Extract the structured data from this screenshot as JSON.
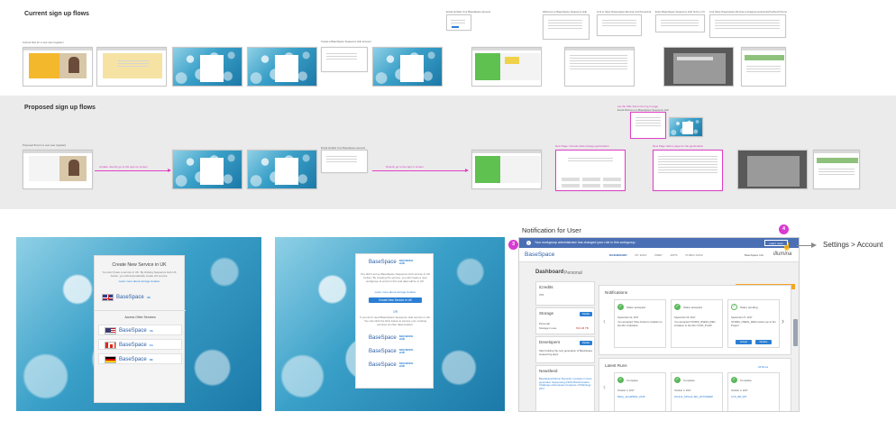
{
  "sections": {
    "current_title": "Current sign up flows",
    "proposed_title": "Proposed sign up flows"
  },
  "current_captions": {
    "c1": "Current flow for a new user (register)",
    "c2": "Create a BaseSpace Sequence Hub account",
    "c3": "Email Verified Your BaseSpace account",
    "c4": "Welcome to BaseSpace Sequence Hub",
    "c5": "Link to https://basespace.illumina.com/home/index",
    "c6": "Enter BaseSpace Sequence Hub Terms of Use Accepted",
    "c7": "Link https://basespace.illumina.com/agreements/eula?redirect=/home"
  },
  "proposed_captions": {
    "p1": "Proposed flow for a new user (register)",
    "p_arrow1": "Update: directly go to the sign up screen",
    "p_arrow2": "Directly go to the sign in screen",
    "p3": "Email Verified Your BaseSpace account",
    "p_new_choose": "New Page: Choose data storage geolocation",
    "p_top_note": "Let the URL link to the log in page",
    "p_top_note2": "Email Welcome to BaseSpace Sequence Hub",
    "p_new_geo": "New Page: Edit a page for the geolocation"
  },
  "create_dialog": {
    "title": "Create New Service in UK",
    "text": "You don't have a service in UK. By clicking Sequence Hub UK button, you will automatically create UK service.",
    "link": "Learn more about storage location",
    "basespace": "BaseSpace",
    "hub": "SEQUENCE\nHUB",
    "hub_region": "UK",
    "access_title": "Access Other Services",
    "regions": [
      "US",
      "CA",
      "DE"
    ]
  },
  "second_dialog": {
    "text": "You didn't set up BaseSpace Sequence Hub service in UK before. By creating the service, you will create a new workgroup at work for this and data will be in UK.",
    "link": "Learn more about storage location",
    "button": "Create New Service in UK",
    "or": "OR",
    "or_text": "If you don't need BaseSpace Sequence Hub service in UK. You can click the links below to access your existing services at other data location.",
    "basespace": "BaseSpace",
    "hub": "SEQUENCE\nHUB"
  },
  "notification": {
    "heading": "Notification for User",
    "banner": "Your workgroup administrator has changed your role in this workgroup.",
    "banner_button": "Learn more",
    "badge_left": "3",
    "badge_right": "4",
    "arrow_target": "Settings > Account",
    "app_logo": "BaseSpace",
    "nav": [
      "DASHBOARD",
      "MY DATA",
      "PREP",
      "APPS",
      "PUBLIC DATA"
    ],
    "illumina": "illumina",
    "user": "BaseSpace Info",
    "dashboard_title": "Dashboard",
    "dashboard_scope": "Personal",
    "alert": "We've made some changes. Visit their ...",
    "icredits": "iCredits",
    "icredits_value": "379",
    "storage": "Storage",
    "storage_button": "Details",
    "storage_personal": "Personal",
    "storage_line2": "Storage in use",
    "storage_value": "519.48 TB",
    "developers": "Developers",
    "developers_button": "Details",
    "developers_text": "Start building the next generation of BaseSpace sequencing apps.",
    "newsfeed": "Newsfeed",
    "newsfeed_text": "BaseSpace/Partner Recorder complete in Next-generation Sequencing (NGS) Bioinformatics Challenge at European Congress of Pathology 2017",
    "notifications_title": "Notifications",
    "cards": [
      {
        "status": "Share accepted",
        "date": "September 22, 2017",
        "text": "You accepted Yilian Fisher's invitation to the Run Individual"
      },
      {
        "status": "Share accepted",
        "date": "September 26, 2017",
        "text": "You accepted ST2000_OSE91_REN invitation to the Run ST2K_PoolD"
      },
      {
        "status": "Share pending",
        "date": "September 27, 2017",
        "text": "ST2000_OSE91_REN invited you to the Project",
        "accept": "Accept",
        "decline": "Decline"
      }
    ],
    "latest_runs": "Latest Runs",
    "all_runs": "All Runs",
    "runs": [
      {
        "status": "Complete",
        "date": "October 3, 2017",
        "name": "Mlboy_EcoliPBH4_2X45"
      },
      {
        "status": "Complete",
        "date": "October 3, 2017",
        "name": "101313_SPS-HL-MH_2NTSNMEP"
      },
      {
        "status": "Complete",
        "date": "October 3, 2017",
        "name": "LOS_DB_MIT"
      }
    ]
  }
}
